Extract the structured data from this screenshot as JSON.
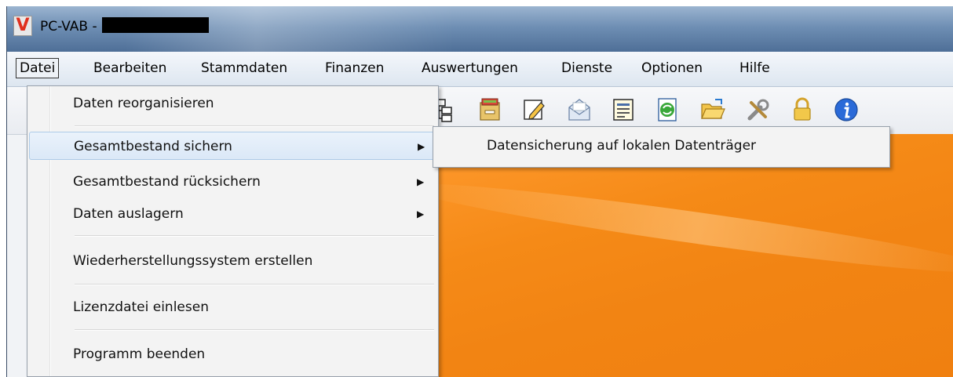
{
  "window": {
    "title": "PC-VAB -",
    "logo_letter": "V"
  },
  "menubar": {
    "items": [
      "Datei",
      "Bearbeiten",
      "Stammdaten",
      "Finanzen",
      "Auswertungen",
      "Dienste",
      "Optionen",
      "Hilfe"
    ],
    "active": "Datei"
  },
  "toolbar": {
    "icons": [
      "tree-icon",
      "file-cabinet-icon",
      "edit-icon",
      "mail-icon",
      "report-icon",
      "refresh-icon",
      "open-folder-icon",
      "tools-icon",
      "lock-icon",
      "info-icon"
    ]
  },
  "datei_menu": {
    "items": [
      {
        "label": "Daten reorganisieren",
        "submenu": false
      },
      {
        "label": "Gesamtbestand sichern",
        "submenu": true
      },
      {
        "label": "Gesamtbestand rücksichern",
        "submenu": true
      },
      {
        "label": "Daten auslagern",
        "submenu": true
      },
      {
        "label": "Wiederherstellungssystem erstellen",
        "submenu": false
      },
      {
        "label": "Lizenzdatei einlesen",
        "submenu": false
      },
      {
        "label": "Programm beenden",
        "submenu": false
      }
    ],
    "highlighted": "Gesamtbestand sichern",
    "arrow_glyph": "▶"
  },
  "submenu": {
    "items": [
      "Datensicherung auf lokalen Datenträger"
    ]
  },
  "colors": {
    "accent_orange": "#f28413",
    "titlebar_blue": "#6f8fb4",
    "menu_highlight": "#dbe8f7"
  }
}
